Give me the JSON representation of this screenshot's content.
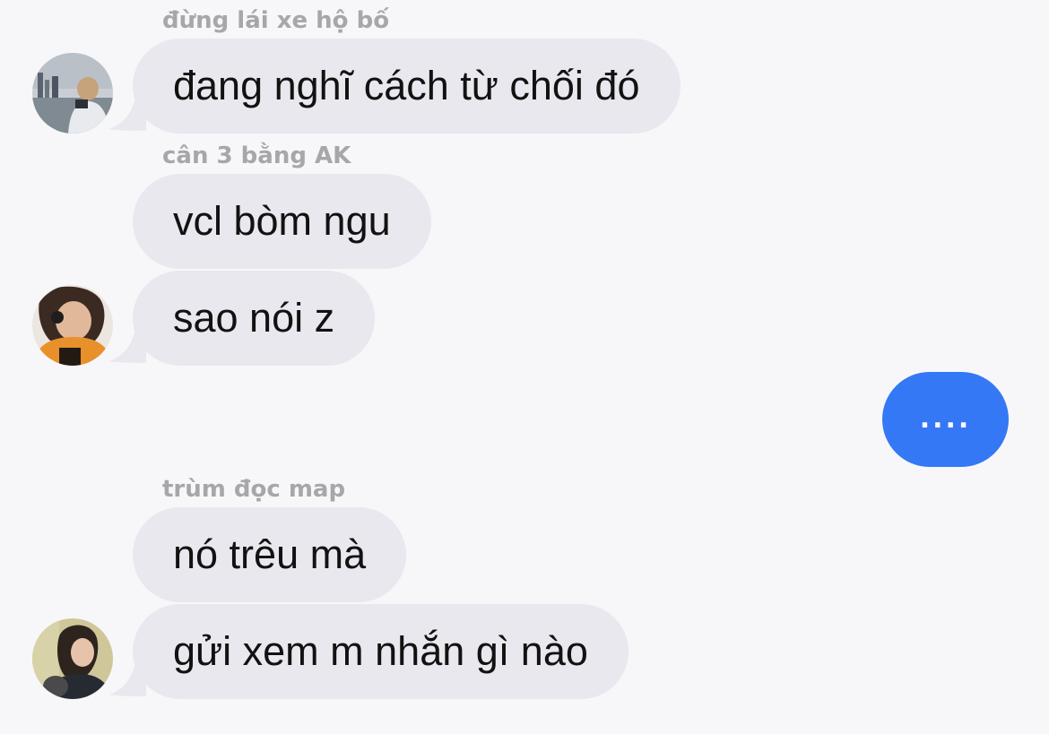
{
  "messages": [
    {
      "sender": "đừng lái xe hộ bố",
      "text": "đang nghĩ cách từ chối đó",
      "avatar": "avatar-city-photo"
    },
    {
      "sender": "cân 3 bằng AK",
      "text": "vcl bòm ngu"
    },
    {
      "text": "sao nói z",
      "avatar": "avatar-girl-headphones-orange"
    },
    {
      "sender": "trùm đọc map",
      "text": "nó trêu mà"
    },
    {
      "text": "gửi xem m nhắn gì nào",
      "avatar": "avatar-girl-with-dog"
    }
  ],
  "outgoing": {
    "text": "...."
  },
  "colors": {
    "background": "#f7f7f9",
    "incoming_bubble": "#e9e8ee",
    "outgoing_bubble": "#3478f6",
    "sender_name": "#a6a6ab",
    "message_text": "#121212"
  }
}
